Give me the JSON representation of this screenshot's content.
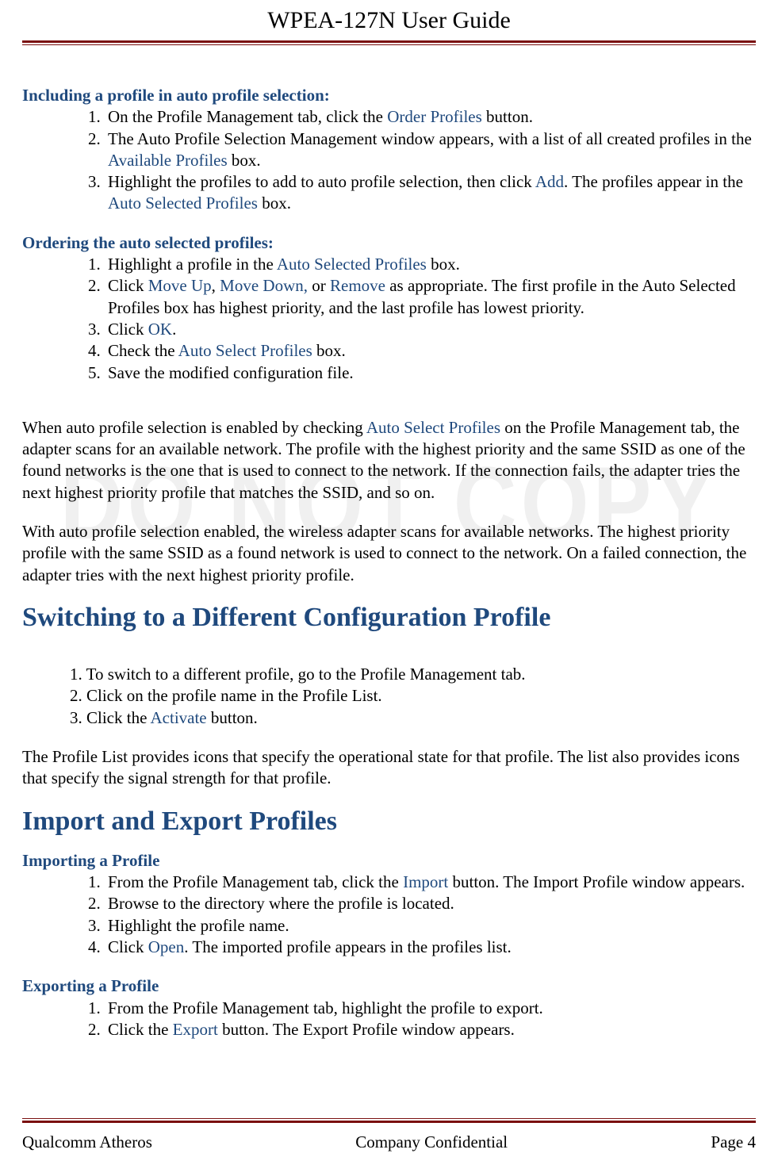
{
  "header": {
    "title": "WPEA-127N User Guide"
  },
  "watermark": "DO NOT COPY",
  "sections": {
    "include": {
      "heading": "Including a profile in auto profile selection:",
      "items": [
        {
          "pre": "On the Profile Management tab, click the ",
          "link": "Order Profiles",
          "post": " button."
        },
        {
          "pre": "The Auto Profile Selection Management window appears, with a list of all created profiles in the ",
          "link": "Available Profiles",
          "post": " box."
        },
        {
          "pre": "Highlight the profiles to add to auto profile selection, then click ",
          "link": "Add",
          "post": ". The profiles appear in the ",
          "link2": "Auto Selected Profiles",
          "post2": " box."
        }
      ]
    },
    "ordering": {
      "heading": "Ordering the auto selected profiles:",
      "item1": {
        "pre": "Highlight a profile in the ",
        "link": "Auto Selected Profiles",
        "post": " box."
      },
      "item2": {
        "pre": "Click ",
        "l1": "Move Up",
        "sep1": ", ",
        "l2": "Move Down,",
        "sep2": " or ",
        "l3": "Remove",
        "post": " as appropriate. The first profile in the Auto Selected Profiles box has highest priority, and the last profile has lowest priority."
      },
      "item3": {
        "pre": "Click ",
        "link": "OK",
        "post": "."
      },
      "item4": {
        "pre": "Check the ",
        "link": "Auto Select Profiles",
        "post": " box."
      },
      "item5": {
        "text": "Save the modified configuration file."
      }
    },
    "para1": {
      "pre": "When auto profile selection is enabled by checking ",
      "link": "Auto Select Profiles",
      "post": " on the Profile Management tab, the adapter scans for an available network. The profile with the highest priority and the same SSID as one of the found networks is the one that is used to connect to the network. If the connection fails, the adapter tries the next highest priority profile that matches the SSID, and so on."
    },
    "para2": "With auto profile selection enabled, the wireless adapter scans for available networks. The highest priority profile with the same SSID as a found network is used to connect to the network. On a failed connection, the adapter tries with the next highest priority profile.",
    "switching": {
      "heading": "Switching to a Different Configuration Profile",
      "item1": "1. To switch to a different profile, go to the Profile Management tab.",
      "item2": "2. Click on the profile name in the Profile List.",
      "item3_pre": "3. Click the ",
      "item3_link": "Activate",
      "item3_post": " button.",
      "para": "The Profile List provides icons that specify the operational state for that profile. The list also provides icons that specify the signal strength for that profile."
    },
    "importexport": {
      "heading": "Import and Export Profiles",
      "importing": {
        "heading": "Importing a Profile",
        "item1": {
          "pre": "From the Profile Management tab, click the ",
          "link": "Import",
          "post": " button. The Import Profile window appears."
        },
        "item2": "Browse to the directory where the profile is located.",
        "item3": "Highlight the profile name.",
        "item4": {
          "pre": "Click ",
          "link": "Open",
          "post": ". The imported profile appears in the profiles list."
        }
      },
      "exporting": {
        "heading": "Exporting a Profile",
        "item1": "From the Profile Management tab, highlight the profile to export.",
        "item2": {
          "pre": "Click the ",
          "link": "Export",
          "post": " button. The Export Profile window appears."
        }
      }
    }
  },
  "footer": {
    "left": "Qualcomm Atheros",
    "center": "Company Confidential",
    "right": "Page 4"
  }
}
